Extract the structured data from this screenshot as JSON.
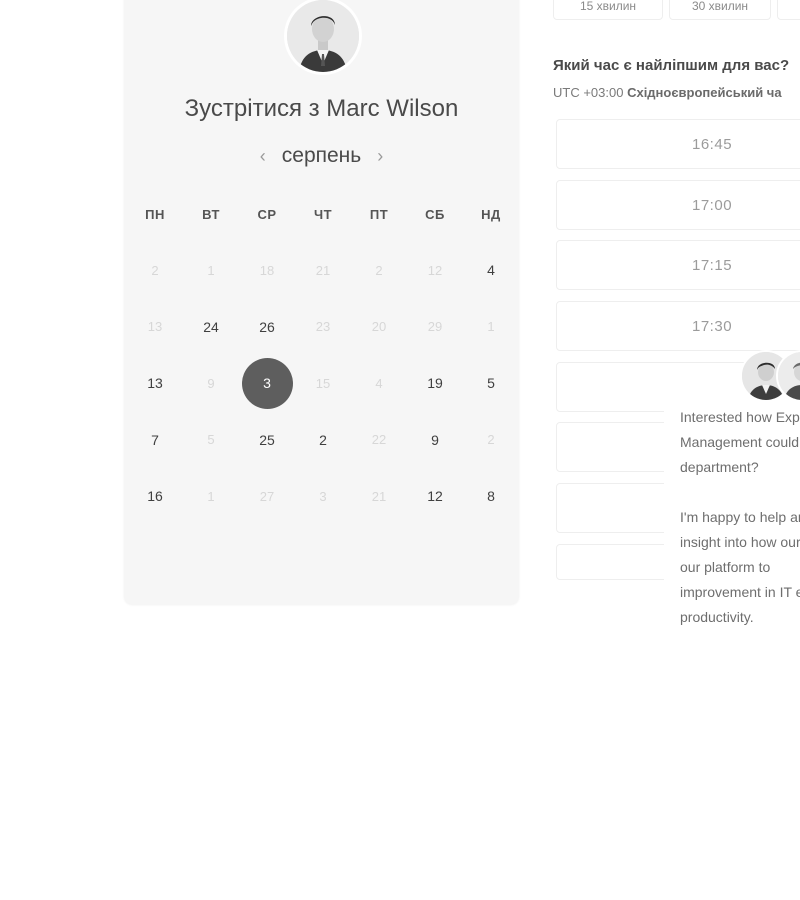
{
  "organizer": {
    "title": "Зустрітися з Marc Wilson"
  },
  "calendar": {
    "month": "серпень",
    "prev_icon": "‹",
    "next_icon": "›",
    "weekdays": [
      "ПН",
      "ВТ",
      "СР",
      "ЧТ",
      "ПТ",
      "СБ",
      "НД"
    ],
    "days": [
      {
        "label": "2",
        "state": "muted"
      },
      {
        "label": "1",
        "state": "muted"
      },
      {
        "label": "18",
        "state": "muted"
      },
      {
        "label": "21",
        "state": "muted"
      },
      {
        "label": "2",
        "state": "muted"
      },
      {
        "label": "12",
        "state": "muted"
      },
      {
        "label": "4",
        "state": "available"
      },
      {
        "label": "13",
        "state": "muted"
      },
      {
        "label": "24",
        "state": "available"
      },
      {
        "label": "26",
        "state": "available"
      },
      {
        "label": "23",
        "state": "muted"
      },
      {
        "label": "20",
        "state": "muted"
      },
      {
        "label": "29",
        "state": "muted"
      },
      {
        "label": "1",
        "state": "muted"
      },
      {
        "label": "13",
        "state": "available"
      },
      {
        "label": "9",
        "state": "muted"
      },
      {
        "label": "3",
        "state": "selected"
      },
      {
        "label": "15",
        "state": "muted"
      },
      {
        "label": "4",
        "state": "muted"
      },
      {
        "label": "19",
        "state": "available"
      },
      {
        "label": "5",
        "state": "available"
      },
      {
        "label": "7",
        "state": "available"
      },
      {
        "label": "5",
        "state": "muted"
      },
      {
        "label": "25",
        "state": "available"
      },
      {
        "label": "2",
        "state": "available"
      },
      {
        "label": "22",
        "state": "muted"
      },
      {
        "label": "9",
        "state": "available"
      },
      {
        "label": "2",
        "state": "muted"
      },
      {
        "label": "16",
        "state": "available"
      },
      {
        "label": "1",
        "state": "muted"
      },
      {
        "label": "27",
        "state": "muted"
      },
      {
        "label": "3",
        "state": "muted"
      },
      {
        "label": "21",
        "state": "muted"
      },
      {
        "label": "12",
        "state": "available"
      },
      {
        "label": "8",
        "state": "available"
      }
    ]
  },
  "durations": [
    "15 хвилин",
    "30 хвилин",
    ""
  ],
  "time_picker": {
    "question": "Який час є найліпшим для вас?",
    "tz_offset": "UTC +03:00",
    "tz_name": "Східноєвропейський ча",
    "slots": [
      "16:45",
      "17:00",
      "17:15",
      "17:30",
      "",
      "",
      "",
      ""
    ]
  },
  "chat": {
    "message_1": "Interested how Exp Management could department?",
    "message_2": "I'm happy to help ar insight into how our use our platform to improvement in IT e productivity."
  }
}
